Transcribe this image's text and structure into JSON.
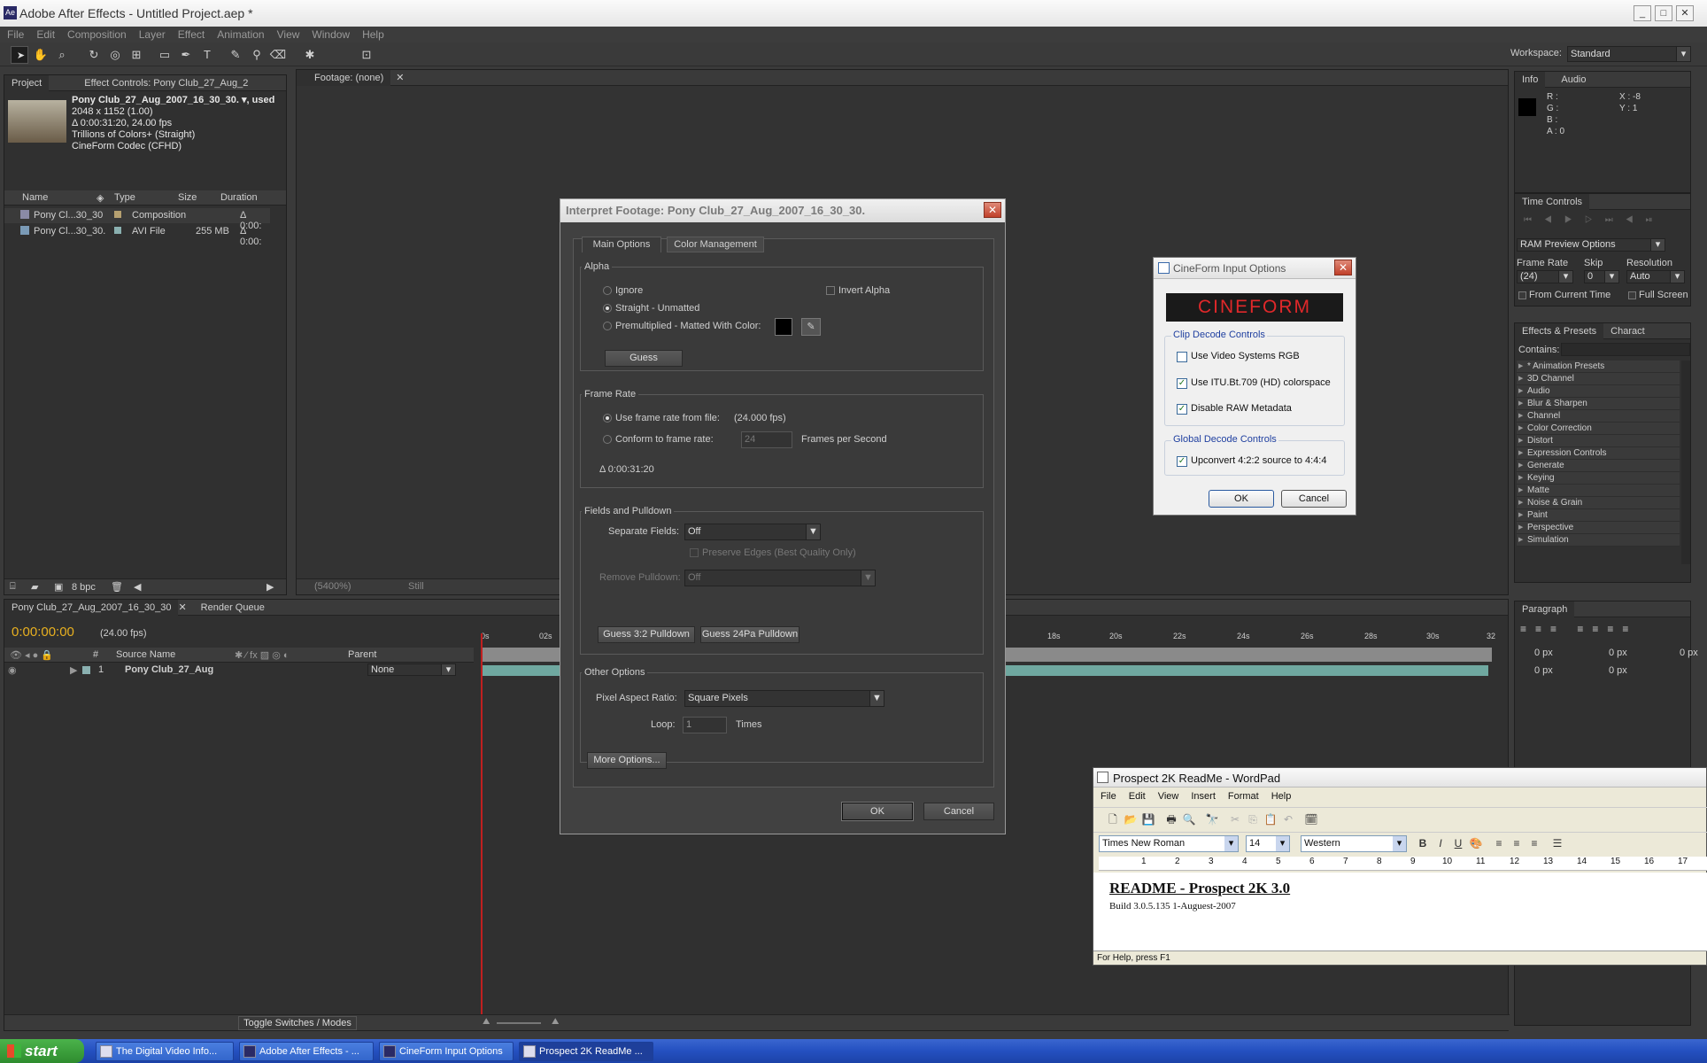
{
  "app": {
    "title": "Adobe After Effects - Untitled Project.aep *",
    "menu": [
      "File",
      "Edit",
      "Composition",
      "Layer",
      "Effect",
      "Animation",
      "View",
      "Window",
      "Help"
    ],
    "workspace_label": "Workspace:",
    "workspace_value": "Standard"
  },
  "project": {
    "tab_project": "Project",
    "tab_effect_controls": "Effect Controls: Pony Club_27_Aug_2",
    "item_name": "Pony Club_27_Aug_2007_16_30_30. ▾, used",
    "dims": "2048 x 1152 (1.00)",
    "duration": "Δ 0:00:31:20, 24.00 fps",
    "colors": "Trillions of Colors+ (Straight)",
    "codec": "CineForm Codec (CFHD)",
    "columns": [
      "Name",
      "Type",
      "Size",
      "Duration"
    ],
    "rows": [
      {
        "name": "Pony Cl...30_30",
        "type": "Composition",
        "size": "",
        "duration": "Δ 0:00:"
      },
      {
        "name": "Pony Cl...30_30.",
        "type": "AVI File",
        "size": "255 MB",
        "duration": "Δ 0:00:"
      }
    ],
    "bpc": "8 bpc"
  },
  "footage": {
    "tab": "Footage: (none)",
    "zoom": "(5400%)",
    "still": "Still"
  },
  "interpret": {
    "title": "Interpret Footage: Pony Club_27_Aug_2007_16_30_30.",
    "tab_main": "Main Options",
    "tab_color": "Color Management",
    "alpha_group": "Alpha",
    "ignore": "Ignore",
    "invert_alpha": "Invert Alpha",
    "straight": "Straight - Unmatted",
    "premultiplied": "Premultiplied - Matted With Color:",
    "guess": "Guess",
    "frame_rate_group": "Frame Rate",
    "use_from_file": "Use frame rate from file:",
    "file_fps": "(24.000 fps)",
    "conform": "Conform to frame rate:",
    "conform_value": "24",
    "fps_unit": "Frames per Second",
    "duration": "Δ 0:00:31:20",
    "fields_group": "Fields and Pulldown",
    "separate_fields": "Separate Fields:",
    "separate_value": "Off",
    "preserve_edges": "Preserve Edges (Best Quality Only)",
    "remove_pulldown": "Remove Pulldown:",
    "pulldown_value": "Off",
    "guess32": "Guess 3:2 Pulldown",
    "guess24": "Guess 24Pa Pulldown",
    "other_group": "Other Options",
    "par_label": "Pixel Aspect Ratio:",
    "par_value": "Square Pixels",
    "loop_label": "Loop:",
    "loop_value": "1",
    "times": "Times",
    "more": "More Options...",
    "ok": "OK",
    "cancel": "Cancel"
  },
  "cineform": {
    "title": "CineForm Input Options",
    "logo": "CINEFORM",
    "clip_group": "Clip Decode Controls",
    "opt1": "Use Video Systems RGB",
    "opt2": "Use ITU.Bt.709 (HD) colorspace",
    "opt3": "Disable RAW Metadata",
    "global_group": "Global Decode Controls",
    "opt4": "Upconvert 4:2:2 source to 4:4:4",
    "ok": "OK",
    "cancel": "Cancel"
  },
  "info": {
    "tab_info": "Info",
    "tab_audio": "Audio",
    "r": "R :",
    "g": "G :",
    "b": "B :",
    "a": "A : 0",
    "x": "X : -8",
    "y": "Y : 1"
  },
  "time_controls": {
    "tab": "Time Controls",
    "ram": "RAM Preview Options",
    "frame_rate": "Frame Rate",
    "skip": "Skip",
    "resolution": "Resolution",
    "fr_value": "(24)",
    "skip_value": "0",
    "res_value": "Auto",
    "from_current": "From Current Time",
    "full_screen": "Full Screen"
  },
  "effects": {
    "tab": "Effects & Presets",
    "tab2": "Charact",
    "contains": "Contains:",
    "items": [
      "* Animation Presets",
      "3D Channel",
      "Audio",
      "Blur & Sharpen",
      "Channel",
      "Color Correction",
      "Distort",
      "Expression Controls",
      "Generate",
      "Keying",
      "Matte",
      "Noise & Grain",
      "Paint",
      "Perspective",
      "Simulation"
    ]
  },
  "paragraph": {
    "tab": "Paragraph",
    "px1": "0 px",
    "px2": "0 px",
    "px3": "0 px",
    "px4": "0 px",
    "px5": "0 px"
  },
  "timeline": {
    "tab": "Pony Club_27_Aug_2007_16_30_30",
    "render_queue": "Render Queue",
    "timecode": "0:00:00:00",
    "fps": "(24.00 fps)",
    "col_num": "#",
    "col_source": "Source Name",
    "col_parent": "Parent",
    "layer_num": "1",
    "layer_name": "Pony Club_27_Aug",
    "parent_value": "None",
    "toggle": "Toggle Switches / Modes",
    "ticks": [
      "0s",
      "02s",
      "18s",
      "20s",
      "22s",
      "24s",
      "26s",
      "28s",
      "30s",
      "32"
    ]
  },
  "wordpad": {
    "title": "Prospect 2K ReadMe - WordPad",
    "menu": [
      "File",
      "Edit",
      "View",
      "Insert",
      "Format",
      "Help"
    ],
    "font": "Times New Roman",
    "size": "14",
    "script": "Western",
    "heading": "README - Prospect 2K 3.0",
    "build": "Build 3.0.5.135 1-Auguest-2007",
    "status": "For Help, press F1",
    "ruler": [
      "1",
      "2",
      "3",
      "4",
      "5",
      "6",
      "7",
      "8",
      "9",
      "10",
      "11",
      "12",
      "13",
      "14",
      "15",
      "16",
      "17"
    ]
  },
  "taskbar": {
    "start": "start",
    "tasks": [
      "The Digital Video Info...",
      "Adobe After Effects - ...",
      "CineForm Input Options",
      "Prospect 2K ReadMe ..."
    ]
  }
}
